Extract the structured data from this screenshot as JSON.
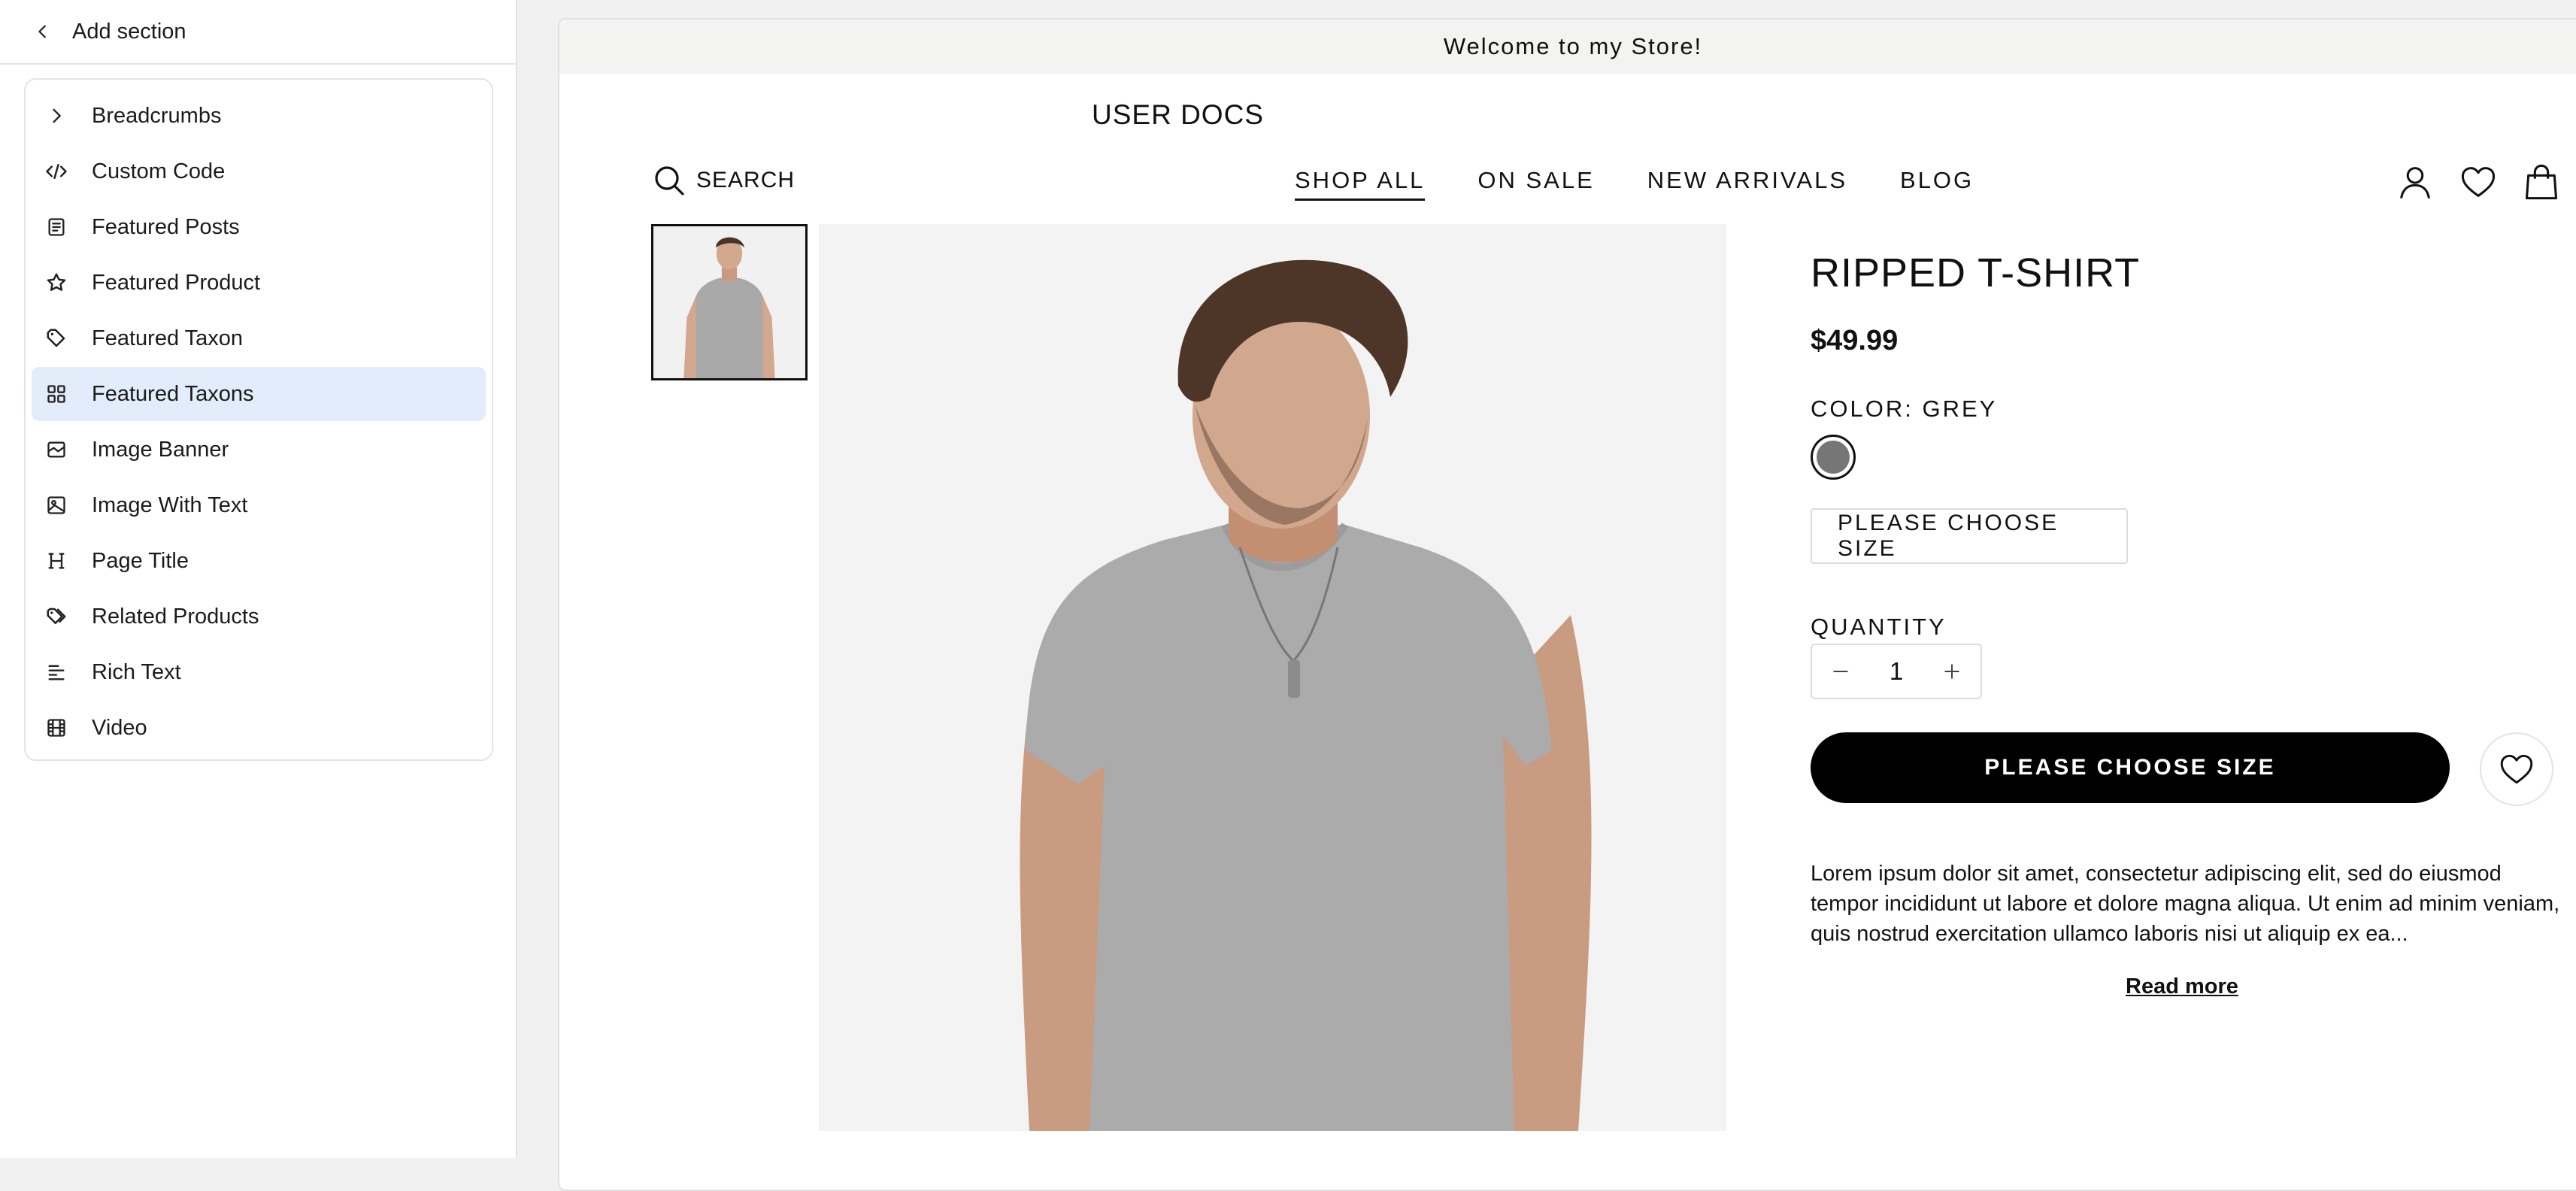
{
  "panel": {
    "title": "Add section",
    "items": [
      {
        "label": "Breadcrumbs",
        "icon": "chevron-right-icon"
      },
      {
        "label": "Custom Code",
        "icon": "code-icon"
      },
      {
        "label": "Featured Posts",
        "icon": "posts-icon"
      },
      {
        "label": "Featured Product",
        "icon": "star-icon"
      },
      {
        "label": "Featured Taxon",
        "icon": "tag-icon"
      },
      {
        "label": "Featured Taxons",
        "icon": "grid-icon"
      },
      {
        "label": "Image Banner",
        "icon": "image-banner-icon"
      },
      {
        "label": "Image With Text",
        "icon": "image-icon"
      },
      {
        "label": "Page Title",
        "icon": "heading-icon"
      },
      {
        "label": "Related Products",
        "icon": "tags-icon"
      },
      {
        "label": "Rich Text",
        "icon": "text-align-icon"
      },
      {
        "label": "Video",
        "icon": "film-icon"
      }
    ],
    "highlighted": "Featured Taxons"
  },
  "store": {
    "announcement": "Welcome to my Store!",
    "brand": "USER DOCS",
    "search_label": "SEARCH",
    "nav": [
      "SHOP ALL",
      "ON SALE",
      "NEW ARRIVALS",
      "BLOG"
    ],
    "active_nav": "SHOP ALL"
  },
  "product": {
    "title": "RIPPED T-SHIRT",
    "price": "$49.99",
    "color_label": "COLOR: GREY",
    "swatch_color": "#767676",
    "size_placeholder": "PLEASE CHOOSE SIZE",
    "quantity_label": "QUANTITY",
    "quantity": "1",
    "add_button": "PLEASE CHOOSE SIZE",
    "description": "Lorem ipsum dolor sit amet, consectetur adipiscing elit, sed do eiusmod tempor incididunt ut labore et dolore magna aliqua. Ut enim ad minim veniam, quis nostrud exercitation ullamco laboris nisi ut aliquip ex ea...",
    "read_more": "Read more"
  },
  "colors": {
    "highlight": "#e3ecfa",
    "button": "#000000",
    "announcement_bg": "#f3f3f2"
  }
}
